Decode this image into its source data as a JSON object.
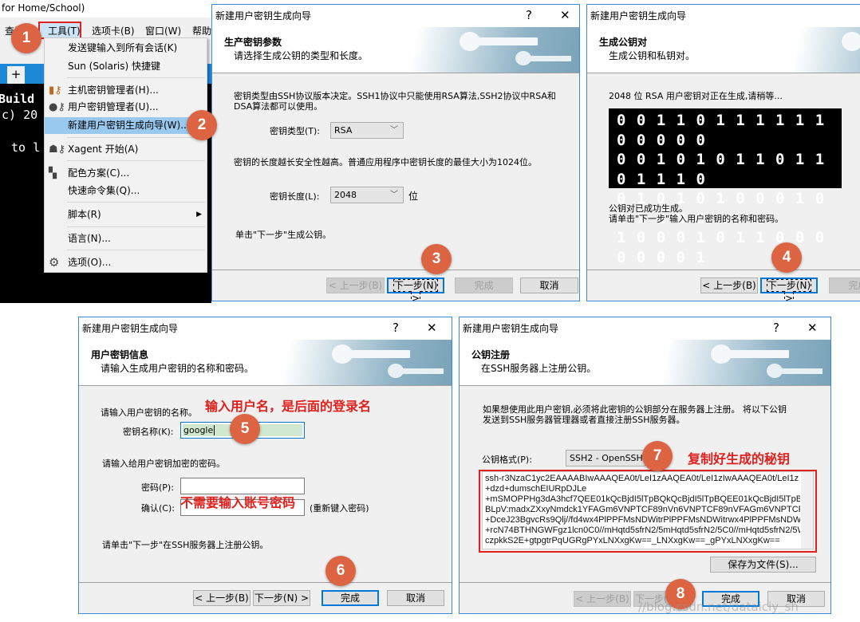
{
  "terminal_window": {
    "title_fragment": "for Home/School)",
    "menubar": [
      "查看",
      "工具(T)",
      "选项卡(B)",
      "窗口(W)",
      "帮助"
    ],
    "tab_add": "+",
    "terminal_lines": [
      "Build",
      "c) 20",
      "to l"
    ]
  },
  "tools_menu": {
    "items": [
      {
        "label": "发送键输入到所有会话(K)",
        "icon": ""
      },
      {
        "label": "Sun (Solaris) 快捷键",
        "icon": ""
      },
      {
        "label": "主机密钥管理者(H)...",
        "icon": "host-key-icon"
      },
      {
        "label": "用户密钥管理者(U)...",
        "icon": "user-key-icon"
      },
      {
        "label": "新建用户密钥生成向导(W)...",
        "icon": "",
        "highlighted": true
      },
      {
        "label": "Xagent 开始(A)",
        "icon": "xagent-icon"
      },
      {
        "label": "配色方案(C)...",
        "icon": "color-scheme-icon"
      },
      {
        "label": "快速命令集(Q)...",
        "icon": ""
      },
      {
        "label": "脚本(R)",
        "icon": "",
        "submenu": true
      },
      {
        "label": "语言(N)...",
        "icon": ""
      },
      {
        "label": "选项(O)...",
        "icon": "gear-icon"
      }
    ]
  },
  "wizard_title": "新建用户密钥生成向导",
  "help_glyph": "?",
  "close_glyph": "✕",
  "buttons": {
    "back": "< 上一步(B)",
    "next": "下一步(N) >",
    "finish": "完成",
    "cancel": "取消"
  },
  "step_params": {
    "header_title": "生产密钥参数",
    "header_sub": "请选择生成公钥的类型和长度。",
    "desc1": "密钥类型由SSH协议版本决定。SSH1协议中只能使用RSA算法,SSH2协议中RSA和",
    "desc2": "DSA算法都可以使用。",
    "key_type_label": "密钥类型(T):",
    "key_type_value": "RSA",
    "length_desc": "密钥的长度越长安全性越高。普通应用程序中密钥长度的最佳大小为1024位。",
    "key_length_label": "密钥长度(L):",
    "key_length_value": "2048",
    "unit": "位",
    "hint": "单击\"下一步\"生成公钥。"
  },
  "step_generate": {
    "header_title": "生成公钥对",
    "header_sub": "生成公钥和私钥对。",
    "status": "2048 位 RSA 用户密钥对正在生成,请稍等...",
    "binary_lines": [
      "0011011111100000",
      "0010101101101110",
      "0101010001001100",
      "1000101100000001"
    ],
    "done1": "公钥对已成功生成。",
    "done2": "请单击\"下一步\"输入用户密钥的名称和密码。"
  },
  "step_info": {
    "header_title": "用户密钥信息",
    "header_sub": "请输入生成用户密钥的名称和密码。",
    "name_prompt": "请输入用户密钥的名称。",
    "name_label": "密钥名称(K):",
    "name_value": "google",
    "pass_prompt": "请输入给用户密钥加密的密码。",
    "pass_label": "密码(P):",
    "confirm_label": "确认(C):",
    "confirm_hint": "(重新键入密码)",
    "hint": "请单击\"下一步\"在SSH服务器上注册公钥。"
  },
  "step_register": {
    "header_title": "公钥注册",
    "header_sub": "在SSH服务器上注册公钥。",
    "desc1": "如果想使用此用户密钥,必须将此密钥的公钥部分在服务器上注册。 将以下公钥",
    "desc2": "发送到SSH服务器管理器或者直接注册SSH服务器。",
    "format_label": "公钥格式(P):",
    "format_value": "SSH2 - OpenSSH",
    "key_lines": [
      "ssh-r3NzaC1yc2EAAAABIwAAAQEA0t/LeI1zAAQEA0t/LeI1zIwAAAQEA0t/LeI1z",
      "+dzd+dumschEIURpDJLe",
      "+mSMOPPHg3dA3hcf7QEE01kQcBjdI5lTpBQkQcBjdI5lTpBQEE01kQcBjdI5lTpBPh",
      "BLpV:madxZXxyNmdck1YFAGm6VNPTCF89nVn6VNPTCF89nVFAGm6VNPTCF89nV",
      "+DceJ23BgvcRs9Qlj//fd4wx4PlPPFMsNDWitrPlPPFMsNDWitrwx4PlPPFMsNDWitr",
      "+rcN74BTHNGWFgz1lcn0C0//mHqtd5sfrN2/5mHqtd5sfrN2/5C0//mHqtd5sfrN2/5W",
      "czpkkS2E+gtpgtrPqUGRgPYxLNXxgKw==_LNXxgKw==_gPYxLNXxgKw=="
    ],
    "save_button": "保存为文件(S)..."
  },
  "annotations": {
    "steps": [
      "1",
      "2",
      "3",
      "4",
      "5",
      "6",
      "7",
      "8"
    ],
    "note_username": "输入用户名，是后面的登录名",
    "note_password": "不需要输入账号密码",
    "note_copy": "复制好生成的秘钥",
    "accent_color": "#dc6443",
    "note_color": "#e0201c"
  },
  "watermark": "//blog.csdn.net/dataiciy_sh"
}
